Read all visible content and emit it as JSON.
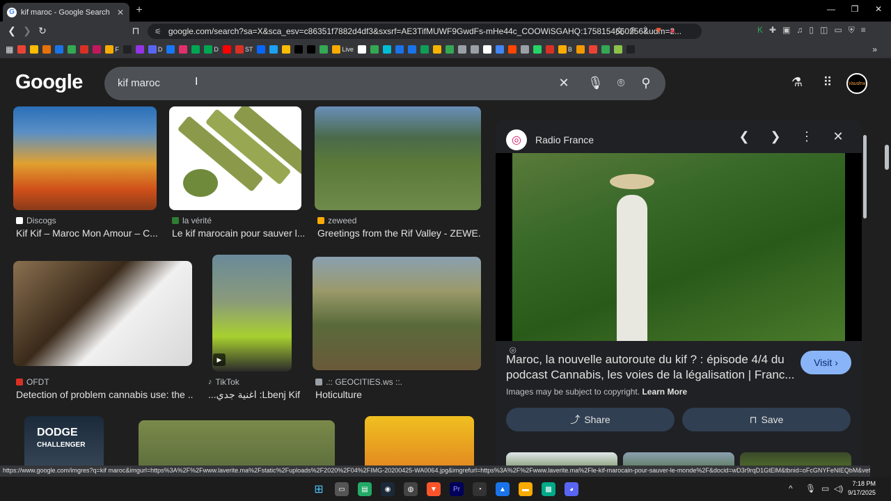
{
  "browser": {
    "tab_title": "kif maroc - Google Search",
    "tab_favicon": "G",
    "tab_close": "✕",
    "new_tab": "+",
    "url": "google.com/search?sa=X&sca_esv=c86351f7882d4df3&sxsrf=AE3TifMUWF9GwdFs-mHe44c_COOWiSGAHQ:1758154660256&udm=2...",
    "bookmarks": [
      {
        "label": "",
        "color": "#ea4335"
      },
      {
        "label": "",
        "color": "#fbbc04"
      },
      {
        "label": "",
        "color": "#e8710a"
      },
      {
        "label": "",
        "color": "#1a73e8"
      },
      {
        "label": "",
        "color": "#34a853"
      },
      {
        "label": "",
        "color": "#d93025"
      },
      {
        "label": "",
        "color": "#c2185b"
      },
      {
        "label": "F",
        "color": "#f9ab00"
      },
      {
        "label": "",
        "color": "#202124"
      },
      {
        "label": "",
        "color": "#9334e6"
      },
      {
        "label": "D",
        "color": "#5865f2"
      },
      {
        "label": "",
        "color": "#1877f2"
      },
      {
        "label": "",
        "color": "#e1306c"
      },
      {
        "label": "",
        "color": "#00a651"
      },
      {
        "label": "D",
        "color": "#00a651"
      },
      {
        "label": "",
        "color": "#ff0000"
      },
      {
        "label": "ST",
        "color": "#d93025"
      },
      {
        "label": "",
        "color": "#0866ff"
      },
      {
        "label": "",
        "color": "#1da1f2"
      },
      {
        "label": "",
        "color": "#fbbc04"
      },
      {
        "label": "",
        "color": "#000000"
      },
      {
        "label": "",
        "color": "#000000"
      },
      {
        "label": "",
        "color": "#34a853"
      },
      {
        "label": "Live",
        "color": "#f9ab00"
      },
      {
        "label": "",
        "color": "#ffffff"
      },
      {
        "label": "",
        "color": "#34a853"
      },
      {
        "label": "",
        "color": "#00bcd4"
      },
      {
        "label": "",
        "color": "#1a73e8"
      },
      {
        "label": "",
        "color": "#1a73e8"
      },
      {
        "label": "",
        "color": "#0f9d58"
      },
      {
        "label": "",
        "color": "#f4b400"
      },
      {
        "label": "",
        "color": "#34a853"
      },
      {
        "label": "",
        "color": "#9aa0a6"
      },
      {
        "label": "",
        "color": "#9aa0a6"
      },
      {
        "label": "",
        "color": "#ffffff"
      },
      {
        "label": "",
        "color": "#4285f4"
      },
      {
        "label": "",
        "color": "#ff4500"
      },
      {
        "label": "",
        "color": "#9aa0a6"
      },
      {
        "label": "",
        "color": "#25d366"
      },
      {
        "label": "",
        "color": "#d93025"
      },
      {
        "label": "B",
        "color": "#f9ab00"
      },
      {
        "label": "",
        "color": "#f29900"
      },
      {
        "label": "",
        "color": "#ea4335"
      },
      {
        "label": "",
        "color": "#34a853"
      },
      {
        "label": "",
        "color": "#8bc34a"
      },
      {
        "label": "",
        "color": "#202124"
      }
    ]
  },
  "google": {
    "logo": "Google",
    "query": "kif maroc"
  },
  "results": [
    {
      "source": "Discogs",
      "title": "Kif Kif – Maroc Mon Amour – C...",
      "source_color": "#ffffff"
    },
    {
      "source": "la vérité",
      "title": "Le kif marocain pour sauver l...",
      "source_color": "#2e7d32"
    },
    {
      "source": "zeweed",
      "title": "Greetings from the Rif Valley - ZEWE...",
      "source_color": "#f9ab00"
    },
    {
      "source": "OFDT",
      "title": "Detection of problem cannabis use: the ...",
      "source_color": "#d93025"
    },
    {
      "source": "TikTok",
      "title": "...اغنية جدي :Lbenj Kif Kif",
      "source_color": "#000000"
    },
    {
      "source": ".:: GEOCITIES.ws ::.",
      "title": "Hoticulture",
      "source_color": "#9aa0a6"
    }
  ],
  "panel": {
    "source": "Radio France",
    "title": "Maroc, la nouvelle autoroute du kif ? : épisode 4/4 du podcast Cannabis, les voies de la légalisation | Franc...",
    "visit": "Visit",
    "copyright": "Images may be subject to copyright.",
    "learn_more": "Learn More",
    "share": "Share",
    "save": "Save"
  },
  "status_url": "https://www.google.com/imgres?q=kif maroc&imgurl=https%3A%2F%2Fwww.laverite.ma%2Fstatic%2Fuploads%2F2020%2F04%2FIMG-20200425-WA0064.jpg&imgrefurl=https%3A%2F%2Fwww.laverite.ma%2Fle-kif-marocain-pour-sauver-le-monde%2F&docid=wD3r9rqD1GtElM&tbnid=oFcGNYFeNIEQbM&vet...",
  "clock": {
    "time": "7:18 PM",
    "date": "9/17/2025"
  }
}
